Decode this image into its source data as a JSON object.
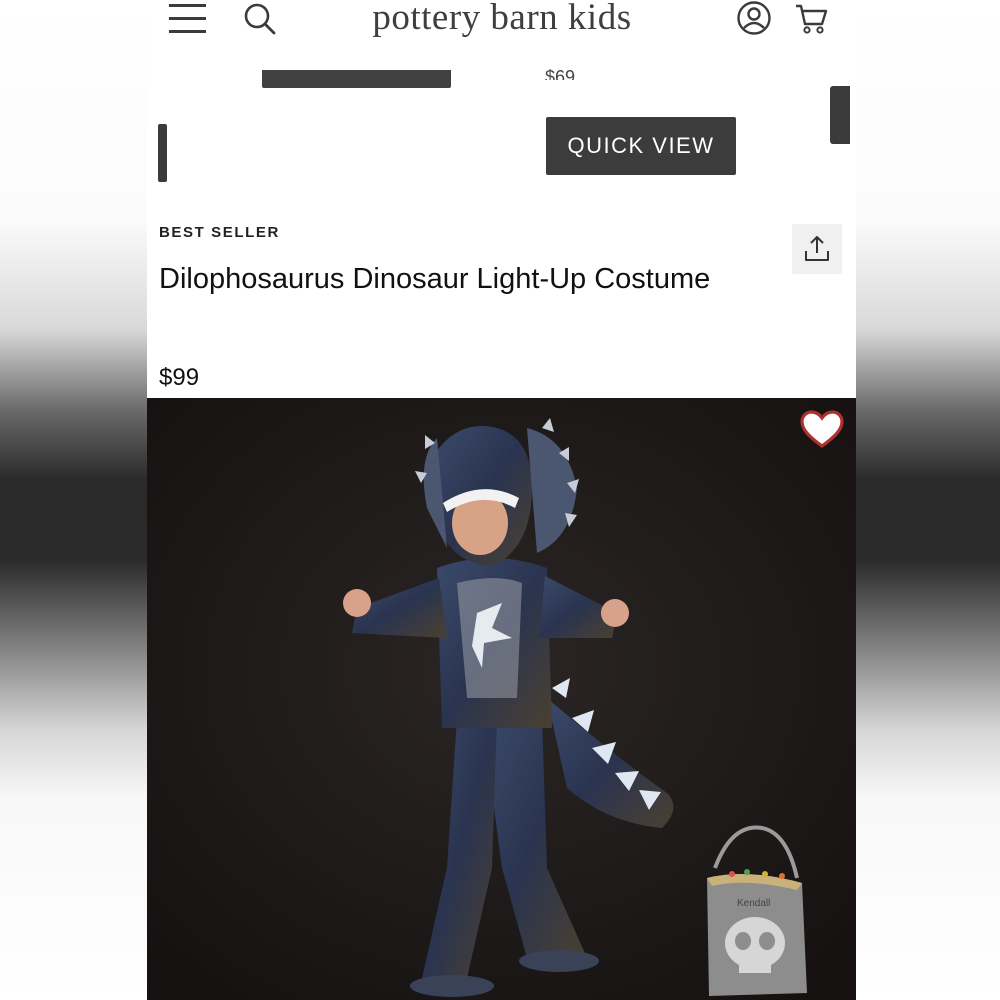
{
  "header": {
    "logo": "pottery barn kids",
    "icons": [
      "menu-icon",
      "search-icon",
      "account-icon",
      "cart-icon"
    ]
  },
  "carousel": {
    "peek_price": "$69",
    "quick_view_label": "QUICK VIEW"
  },
  "product": {
    "badge": "BEST SELLER",
    "title": "Dilophosaurus Dinosaur Light-Up Costume",
    "price": "$99",
    "bucket_name": "Kendall"
  },
  "colors": {
    "button_bg": "#3c3c3c",
    "text": "#111111",
    "heart": "#b03030"
  }
}
